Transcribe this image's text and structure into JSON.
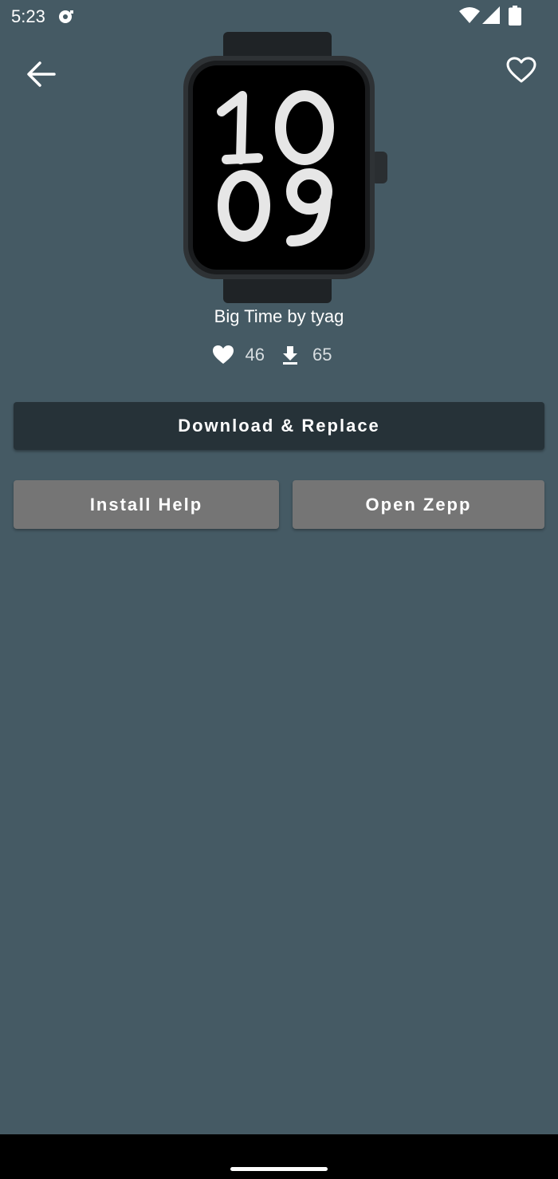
{
  "status_bar": {
    "time": "5:23",
    "icons": [
      "notification-icon",
      "wifi-icon",
      "signal-icon",
      "battery-icon"
    ]
  },
  "header": {
    "back_icon": "arrow-left-icon",
    "favorite_icon": "heart-outline-icon"
  },
  "watchface": {
    "image_icon": "watch-preview-image",
    "title": "Big Time by tyag",
    "likes": "46",
    "downloads": "65",
    "likes_icon": "heart-icon",
    "downloads_icon": "download-icon"
  },
  "actions": {
    "primary_label": "Download & Replace",
    "install_help_label": "Install Help",
    "open_zepp_label": "Open Zepp"
  },
  "colors": {
    "background": "#455a64",
    "primary_button": "#263238",
    "secondary_button": "#757575",
    "text": "#ffffff"
  }
}
